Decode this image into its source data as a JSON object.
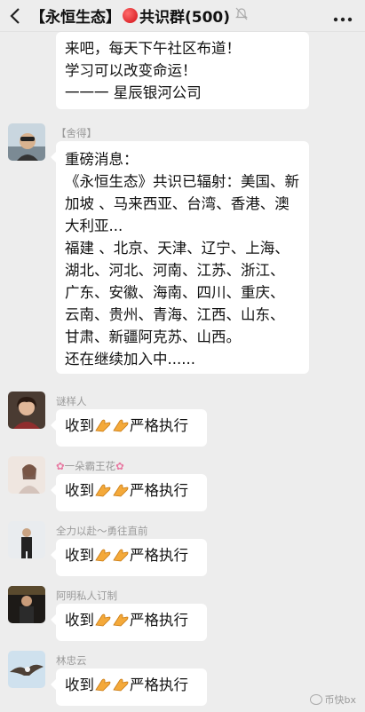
{
  "header": {
    "back_icon": "chevron-left-icon",
    "title_part1": "【永恒生态】",
    "title_part2": "共识群(500)",
    "status_dot_color": "#e0141b",
    "mute_icon": "bell-muted-icon",
    "more_icon": "more-dots-icon"
  },
  "messages": [
    {
      "lines": [
        "来吧，每天下午社区布道！",
        "学习可以改变命运！",
        "一一一 星辰银河公司"
      ]
    },
    {
      "sender": "【舍得】",
      "lines": [
        "重磅消息：",
        "《永恒生态》共识已辐射：美国、新",
        "加坡 、马来西亚、台湾、香港、澳",
        "大利亚...",
        "福建 、北京、天津、辽宁、上海、",
        "湖北、河北、河南、江苏、浙江、",
        "广东、安徽、海南、四川、重庆、",
        "云南、贵州、青海、江西、山东、",
        "甘肃、新疆阿克苏、山西。",
        "还在继续加入中......"
      ]
    },
    {
      "sender": "谜样人",
      "text_a": "收到",
      "text_b": "严格执行"
    },
    {
      "sender": "一朵霸王花",
      "text_a": "收到",
      "text_b": "严格执行"
    },
    {
      "sender": "全力以赴～勇往直前",
      "text_a": "收到",
      "text_b": "严格执行"
    },
    {
      "sender": "阿明私人订制",
      "text_a": "收到",
      "text_b": "严格执行"
    },
    {
      "sender": "林忠云",
      "text_a": "收到",
      "text_b": "严格执行"
    }
  ],
  "watermark": {
    "text": "币快bx"
  }
}
